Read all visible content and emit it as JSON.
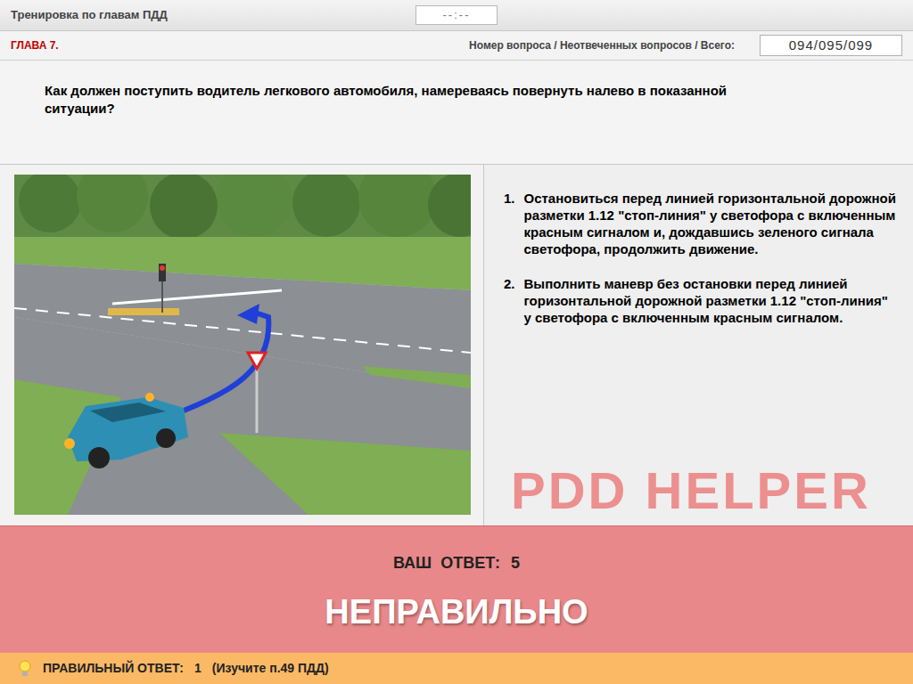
{
  "header": {
    "title": "Тренировка по главам ПДД",
    "timer": "--:--"
  },
  "chapter": {
    "label": "ГЛАВА 7.",
    "counter_label": "Номер вопроса / Неотвеченных вопросов / Всего:",
    "counter": "094/095/099"
  },
  "question": "Как должен поступить водитель легкового автомобиля, намереваясь повернуть налево в показанной ситуации?",
  "answers": [
    {
      "number": "1.",
      "text": "Остановиться перед линией горизонтальной дорожной разметки 1.12 \"стоп-линия\" у светофора с включенным красным сигналом и, дождавшись зеленого сигнала светофора, продолжить движение."
    },
    {
      "number": "2.",
      "text": "Выполнить маневр без остановки перед линией горизонтальной дорожной разметки 1.12 \"стоп-линия\" у светофора с включенным красным сигналом."
    }
  ],
  "watermark": "PDD HELPER",
  "result": {
    "your_answer_label": "ВАШ  ОТВЕТ:",
    "your_answer": "5",
    "verdict": "НЕПРАВИЛЬНО",
    "correct": false
  },
  "correct_answer": {
    "label": "ПРАВИЛЬНЫЙ ОТВЕТ:",
    "value": "1",
    "hint": "(Изучите п.49 ПДД)"
  }
}
